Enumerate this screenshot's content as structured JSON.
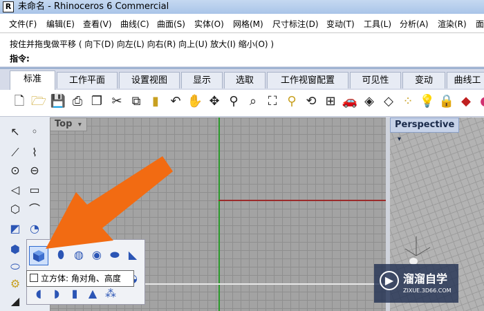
{
  "window": {
    "title": "未命名 - Rhinoceros 6 Commercial",
    "app_icon_glyph": "R"
  },
  "menu": [
    "文件(F)",
    "编辑(E)",
    "查看(V)",
    "曲线(C)",
    "曲面(S)",
    "实体(O)",
    "网格(M)",
    "尺寸标注(D)",
    "变动(T)",
    "工具(L)",
    "分析(A)",
    "渲染(R)",
    "面"
  ],
  "command": {
    "history": "按住并拖曳做平移 ( 向下(D)  向左(L)  向右(R)  向上(U)  放大(I)  缩小(O) )",
    "prompt": "指令:"
  },
  "tabs": [
    {
      "label": "标准",
      "active": true
    },
    {
      "label": "工作平面",
      "active": false
    },
    {
      "label": "设置视图",
      "active": false
    },
    {
      "label": "显示",
      "active": false
    },
    {
      "label": "选取",
      "active": false
    },
    {
      "label": "工作视窗配置",
      "active": false
    },
    {
      "label": "可见性",
      "active": false
    },
    {
      "label": "变动",
      "active": false
    },
    {
      "label": "曲线工",
      "active": false
    }
  ],
  "toolbar_icons": [
    "new-icon",
    "open-icon",
    "save-icon",
    "print-icon",
    "import-icon",
    "cut-icon",
    "copy-icon",
    "paste-icon",
    "undo-icon",
    "pan-icon",
    "rotate-view-icon",
    "zoom-icon",
    "zoom-window-icon",
    "zoom-extents-icon",
    "zoom-selected-icon",
    "rotate-icon",
    "four-viewports-icon",
    "car-icon",
    "hide-icon",
    "show-icon",
    "lock-icon",
    "light-bulb-icon",
    "padlock-icon",
    "layer-icon",
    "render-icon"
  ],
  "viewports": {
    "top": {
      "label": "Top",
      "menu_glyph": "▾"
    },
    "perspective": {
      "label": "Perspective",
      "menu_glyph": "▾"
    }
  },
  "flyout": {
    "tooltip": "立方体: 角对角、高度"
  },
  "watermark": {
    "name": "溜溜自学",
    "url": "ZIXUE.3D66.COM"
  },
  "colors": {
    "arrow": "#f26b12",
    "x_axis": "#9a2a2a",
    "y_axis": "#2a9a2a"
  }
}
